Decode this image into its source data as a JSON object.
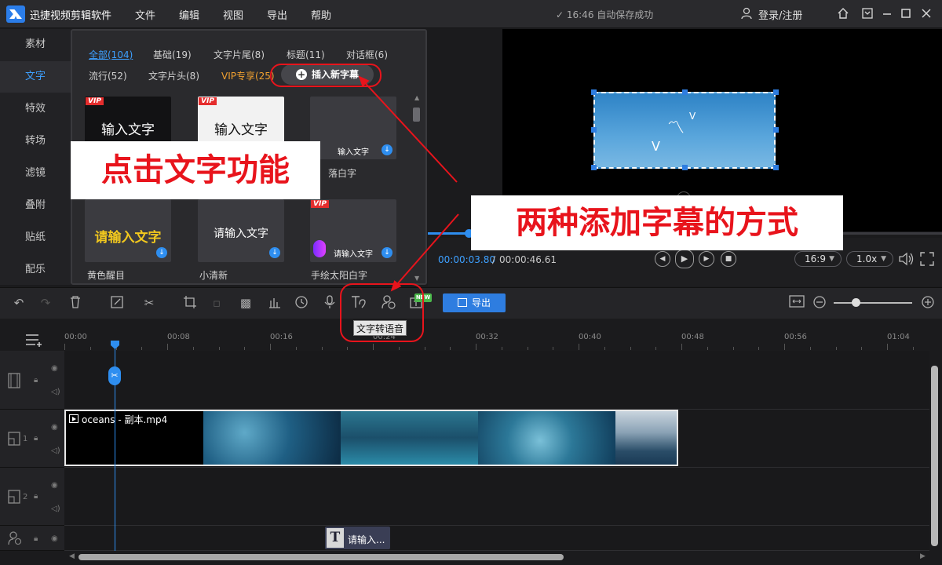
{
  "app": {
    "title": "迅捷视频剪辑软件"
  },
  "menu": [
    "文件",
    "编辑",
    "视图",
    "导出",
    "帮助"
  ],
  "status": {
    "save": "✓ 16:46 自动保存成功"
  },
  "account": {
    "login": "登录/注册"
  },
  "leftnav": [
    "素材",
    "文字",
    "特效",
    "转场",
    "滤镜",
    "叠附",
    "贴纸",
    "配乐"
  ],
  "library": {
    "categories_row1": [
      "全部(104)",
      "基础(19)",
      "文字片尾(8)",
      "标题(11)",
      "对话框(6)"
    ],
    "categories_row2": [
      "流行(52)",
      "文字片头(8)",
      "VIP专享(25)"
    ],
    "insert_button": "插入新字幕",
    "vip_tag": "VIP",
    "thumbs": [
      {
        "text": "输入文字",
        "label": ""
      },
      {
        "text": "输入文字",
        "label": ""
      },
      {
        "text": "输入文字",
        "label": "落白字"
      },
      {
        "text": "请输入文字",
        "label": "黄色醒目"
      },
      {
        "text": "请输入文字",
        "label": "小清新"
      },
      {
        "text": "请输入文字",
        "label": "手绘太阳白字"
      }
    ]
  },
  "player": {
    "current_time": "00:00:03.80",
    "separator": "/",
    "total_time": "00:00:46.61",
    "aspect": "16:9",
    "speed": "1.0x",
    "progress_fraction": 0.08
  },
  "annotations": {
    "callout_1": "点击文字功能",
    "callout_2": "两种添加字幕的方式"
  },
  "toolbar": {
    "export_label": "导出",
    "new_badge": "NEW",
    "tooltip": "文字转语音",
    "zoom_level_fraction": 0.28
  },
  "timeline": {
    "ticks": [
      "00:00",
      "00:08",
      "00:16",
      "00:24",
      "00:32",
      "00:40",
      "00:48",
      "00:56",
      "01:04"
    ],
    "tracks": [
      {
        "label": ""
      },
      {
        "label": "1"
      },
      {
        "label": "2"
      },
      {
        "label": ""
      }
    ],
    "video_clip": "oceans - 副本.mp4",
    "text_clip": "请输入...",
    "text_clip_icon": "T"
  },
  "colors": {
    "accent": "#2e8ef0",
    "annotation_red": "#e8141c",
    "vip": "#f0a030"
  }
}
